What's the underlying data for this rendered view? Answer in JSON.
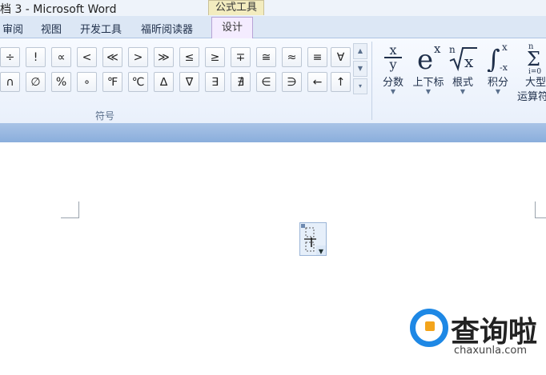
{
  "title_bar": {
    "doc_title": "档 3 - Microsoft Word",
    "context_tab": "公式工具"
  },
  "tabs": [
    {
      "label": "审阅"
    },
    {
      "label": "视图"
    },
    {
      "label": "开发工具"
    },
    {
      "label": "福昕阅读器"
    },
    {
      "label": "设计",
      "active": true
    }
  ],
  "symbols": {
    "row1": [
      "÷",
      "!",
      "∝",
      "<",
      "≪",
      ">",
      "≫",
      "≤",
      "≥",
      "∓",
      "≅",
      "≈",
      "≡",
      "∀"
    ],
    "row2": [
      "∩",
      "∅",
      "%",
      "∘",
      "℉",
      "℃",
      "∆",
      "∇",
      "∃",
      "∄",
      "∈",
      "∋",
      "←",
      "↑"
    ],
    "group_label": "符号"
  },
  "structures": [
    {
      "label": "分数",
      "icon": "fraction-icon",
      "glyph": "x/y"
    },
    {
      "label": "上下标",
      "icon": "script-icon",
      "glyph": "eˣ"
    },
    {
      "label": "根式",
      "icon": "radical-icon",
      "glyph": "ⁿ√x"
    },
    {
      "label": "积分",
      "icon": "integral-icon",
      "glyph": "∫"
    },
    {
      "label": "大型",
      "label2": "运算符",
      "icon": "large-operator-icon",
      "glyph": "Σ"
    }
  ],
  "watermark": {
    "brand": "查询啦",
    "url": "chaxunla.com"
  },
  "colors": {
    "tab_bar": "#dce7f5",
    "active_tab": "#f4ecff",
    "band": "#8aaedc",
    "brand_blue": "#1e88e5",
    "brand_orange": "#f3a41b"
  }
}
